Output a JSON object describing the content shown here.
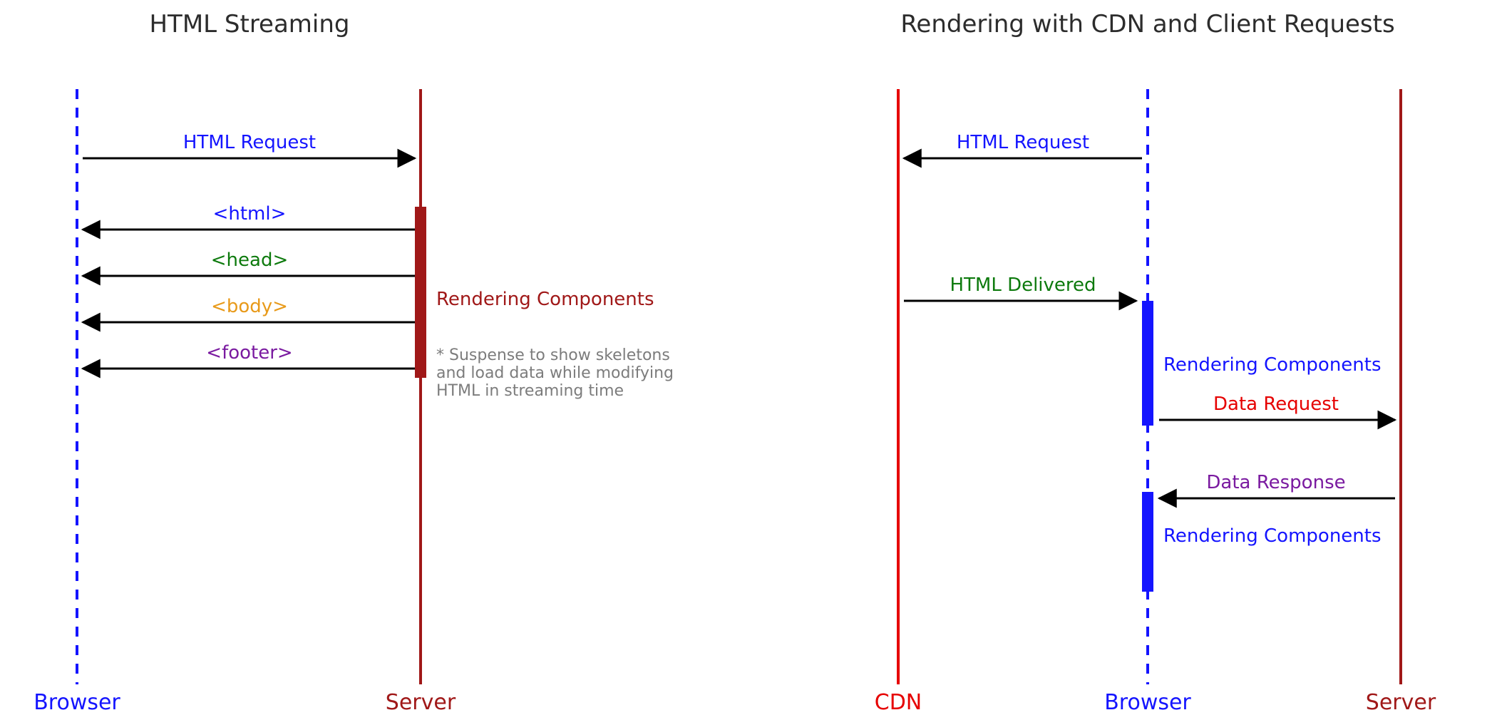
{
  "colors": {
    "title": "#2c2c2c",
    "browser": "#1414ff",
    "server": "#a01818",
    "cdn": "#e60000",
    "black": "#000000",
    "green": "#0d7a0d",
    "orange": "#e89a1a",
    "purple": "#7a1aa0",
    "red": "#e60000",
    "note": "#7c7c7c"
  },
  "left": {
    "title": "HTML Streaming",
    "browser_label": "Browser",
    "server_label": "Server",
    "messages": {
      "req": "HTML Request",
      "html": "<html>",
      "head": "<head>",
      "body": "<body>",
      "footer": "<footer>"
    },
    "activation_label": "Rendering Components",
    "footnote": {
      "l1": "* Suspense to show skeletons",
      "l2": "and load data while modifying",
      "l3": "HTML in streaming time"
    }
  },
  "right": {
    "title": "Rendering with CDN and Client Requests",
    "cdn_label": "CDN",
    "browser_label": "Browser",
    "server_label": "Server",
    "messages": {
      "req": "HTML Request",
      "delivered": "HTML Delivered",
      "render1": "Rendering Components",
      "data_req": "Data Request",
      "data_resp": "Data Response",
      "render2": "Rendering Components"
    }
  }
}
